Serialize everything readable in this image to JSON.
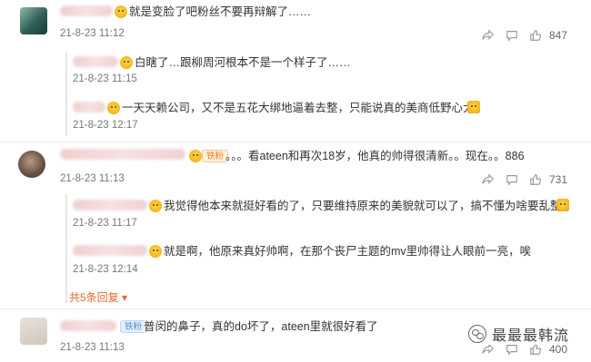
{
  "comments": [
    {
      "text": "就是变脸了吧粉丝不要再辩解了……",
      "time": "21-8-23 11:12",
      "likes": "847",
      "replies": [
        {
          "text": "白瞎了…跟柳周河根本不是一个样子了……",
          "time": "21-8-23 11:15"
        },
        {
          "text": "一天天赖公司，又不是五花大绑地逼着去整，只能说真的美商低野心大",
          "time": "21-8-23 12:17"
        }
      ]
    },
    {
      "badge": "铁粉",
      "text": "。。。看ateen和再次18岁，他真的帅得很清新。。现在。。886",
      "time": "21-8-23 11:13",
      "likes": "731",
      "replies": [
        {
          "text": "我觉得他本来就挺好看的了，只要维持原来的美貌就可以了，搞不懂为啥要乱整",
          "time": "21-8-23 11:17"
        },
        {
          "text": "就是啊，他原来真好帅啊，在那个丧尸主题的mv里帅得让人眼前一亮，唉",
          "time": "21-8-23 12:14"
        }
      ],
      "more_replies": "共5条回复 ▾"
    },
    {
      "badge": "铁粉",
      "text": "普闵的鼻子，真的do坏了，ateen里就很好看了",
      "time": "21-8-23 11:13",
      "likes": "400"
    }
  ],
  "watermark": "最最最韩流",
  "icons": {
    "share": "share-icon",
    "comment": "comment-icon",
    "like": "thumbs-up-icon"
  }
}
